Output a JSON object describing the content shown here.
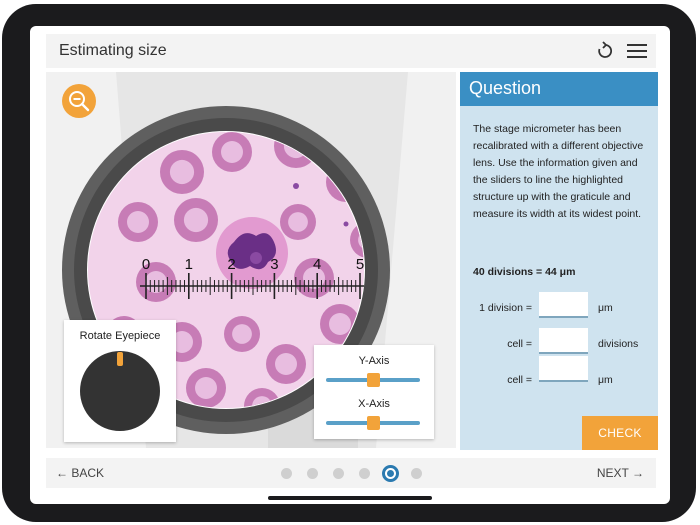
{
  "header": {
    "title": "Estimating size"
  },
  "microscope": {
    "graticule_labels": [
      "0",
      "1",
      "2",
      "3",
      "4",
      "5"
    ],
    "rotate_label": "Rotate Eyepiece",
    "y_axis_label": "Y-Axis",
    "x_axis_label": "X-Axis",
    "y_slider_value": 0.5,
    "x_slider_value": 0.5
  },
  "question": {
    "title": "Question",
    "text": "The stage micrometer has been recalibrated with a different objective lens. Use the information given and the sliders to line the highlighted structure up with the graticule and measure its width at its widest point.",
    "given": "40 divisions = 44 μm",
    "rows": [
      {
        "label": "1 division =",
        "value": "",
        "unit": "μm"
      },
      {
        "label": "cell =",
        "value": "",
        "unit": "divisions"
      },
      {
        "label": "cell =",
        "value": "",
        "unit": "μm"
      }
    ],
    "check_label": "CHECK"
  },
  "footer": {
    "back_label": "BACK",
    "next_label": "NEXT",
    "page_count": 6,
    "active_page": 5
  },
  "colors": {
    "accent": "#f2a33a",
    "question_header": "#3a8fc4",
    "question_bg": "#cfe3ef",
    "cell": "#c97fb8",
    "nucleus": "#6a2f86"
  }
}
